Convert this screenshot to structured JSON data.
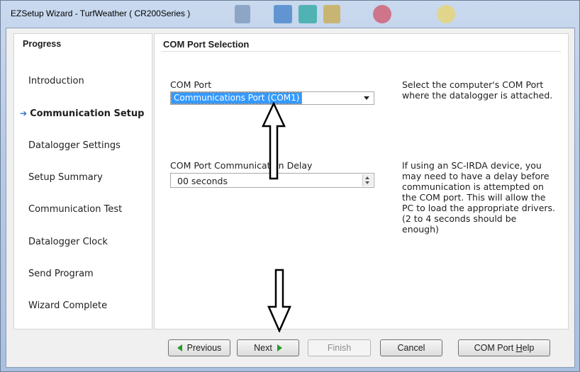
{
  "window": {
    "title": "EZSetup Wizard - TurfWeather ( CR200Series )"
  },
  "progress": {
    "heading": "Progress",
    "current_marker_icon": "arrow-right-icon",
    "steps": [
      {
        "label": "Introduction",
        "current": false
      },
      {
        "label": "Communication Setup",
        "current": true
      },
      {
        "label": "Datalogger Settings",
        "current": false
      },
      {
        "label": "Setup Summary",
        "current": false
      },
      {
        "label": "Communication Test",
        "current": false
      },
      {
        "label": "Datalogger Clock",
        "current": false
      },
      {
        "label": "Send Program",
        "current": false
      },
      {
        "label": "Wizard Complete",
        "current": false
      }
    ]
  },
  "main": {
    "heading": "COM Port Selection",
    "com_port": {
      "label": "COM Port",
      "value": "Communications Port (COM1)",
      "help": "Select the computer's COM Port\nwhere the datalogger is attached."
    },
    "delay": {
      "label": "COM Port Communication Delay",
      "value": "00 seconds",
      "help": "If using an SC-IRDA device, you\nmay need to have a delay before\ncommunication is attempted on\nthe COM port.  This will allow the\nPC to load the appropriate drivers.\n(2 to 4 seconds should be\nenough)"
    }
  },
  "buttons": {
    "previous": "Previous",
    "next": "Next",
    "finish": "Finish",
    "cancel": "Cancel",
    "help_prefix": "COM Port ",
    "help_mnemonic": "H",
    "help_suffix": "elp"
  },
  "colors": {
    "selection": "#3399ff",
    "nav_arrow": "#2a9a2a",
    "current_step_arrow": "#2d6fd0"
  }
}
